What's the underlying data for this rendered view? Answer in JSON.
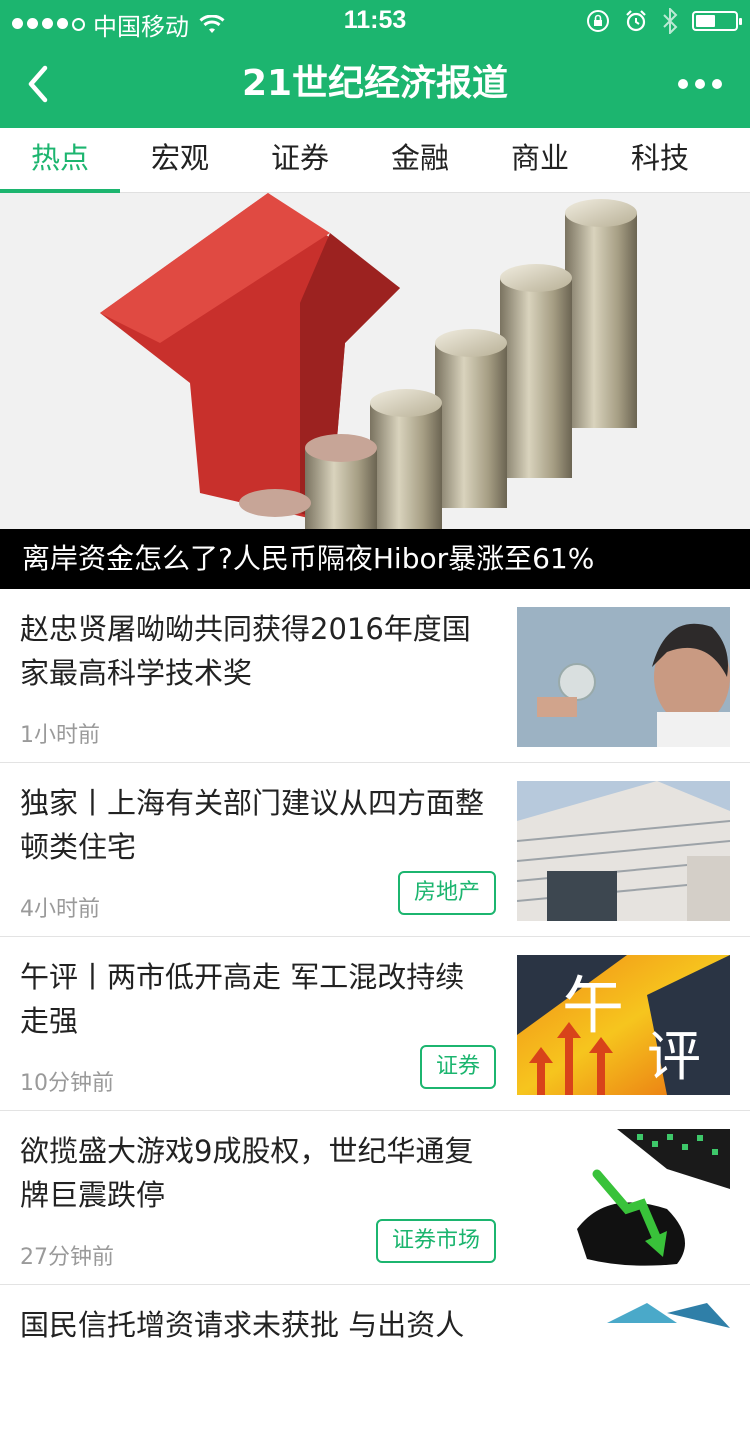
{
  "status_bar": {
    "carrier": "中国移动",
    "time": "11:53",
    "battery_level": 0.5
  },
  "nav": {
    "title": "21世纪经济报道"
  },
  "tabs": [
    {
      "label": "热点",
      "active": true
    },
    {
      "label": "宏观",
      "active": false
    },
    {
      "label": "证券",
      "active": false
    },
    {
      "label": "金融",
      "active": false
    },
    {
      "label": "商业",
      "active": false
    },
    {
      "label": "科技",
      "active": false
    }
  ],
  "hero": {
    "caption": "离岸资金怎么了?人民币隔夜Hibor暴涨至61%"
  },
  "news": [
    {
      "title": "赵忠贤屠呦呦共同获得2016年度国家最高科学技术奖",
      "time": "1小时前",
      "tag": ""
    },
    {
      "title": "独家丨上海有关部门建议从四方面整顿类住宅",
      "time": "4小时前",
      "tag": "房地产"
    },
    {
      "title": "午评丨两市低开高走 军工混改持续走强",
      "time": "10分钟前",
      "tag": "证券",
      "thumb_text": [
        "午",
        "评"
      ]
    },
    {
      "title": "欲揽盛大游戏9成股权，世纪华通复牌巨震跌停",
      "time": "27分钟前",
      "tag": "证券市场"
    },
    {
      "title": "国民信托增资请求未获批 与出资人",
      "time": "",
      "tag": ""
    }
  ],
  "colors": {
    "brand": "#1cb56f",
    "caption_bg": "#000000"
  }
}
